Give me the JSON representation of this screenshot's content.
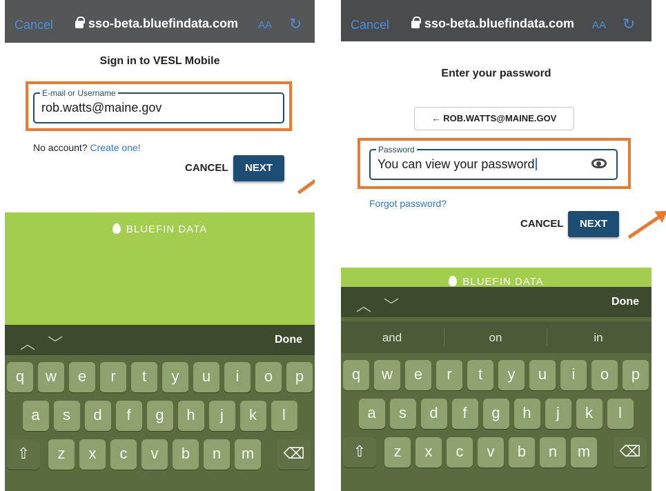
{
  "browser": {
    "cancel_label": "Cancel",
    "url": "sso-beta.bluefindata.com",
    "text_size_label": "AA",
    "reload_glyph": "↻"
  },
  "left_screen": {
    "title": "Sign in to VESL Mobile",
    "field_label": "E-mail or Username",
    "field_value": "rob.watts@maine.gov",
    "no_account_text": "No account?",
    "create_link": "Create one!",
    "cancel_button": "CANCEL",
    "next_button": "NEXT",
    "brand": "BLUEFIN DATA"
  },
  "right_screen": {
    "title": "Enter your password",
    "email_chip": "← ROB.WATTS@MAINE.GOV",
    "field_label": "Password",
    "field_value": "You can view your password",
    "forgot_link": "Forgot password?",
    "cancel_button": "CANCEL",
    "next_button": "NEXT",
    "brand": "BLUEFIN DATA"
  },
  "keyboard": {
    "up_chevron": "︿",
    "down_chevron": "﹀",
    "done_label": "Done",
    "suggestions": [
      "and",
      "on",
      "in"
    ],
    "shift_glyph": "⇧",
    "backspace_glyph": "⌫",
    "row1": [
      "q",
      "w",
      "e",
      "r",
      "t",
      "y",
      "u",
      "i",
      "o",
      "p"
    ],
    "row2": [
      "a",
      "s",
      "d",
      "f",
      "g",
      "h",
      "j",
      "k",
      "l"
    ],
    "row3": [
      "z",
      "x",
      "c",
      "v",
      "b",
      "n",
      "m"
    ]
  },
  "colors": {
    "highlight": "#e87b30",
    "primary": "#1e4d73",
    "brand_green": "#a2cd4f",
    "keyboard": "#5a6b3f"
  }
}
